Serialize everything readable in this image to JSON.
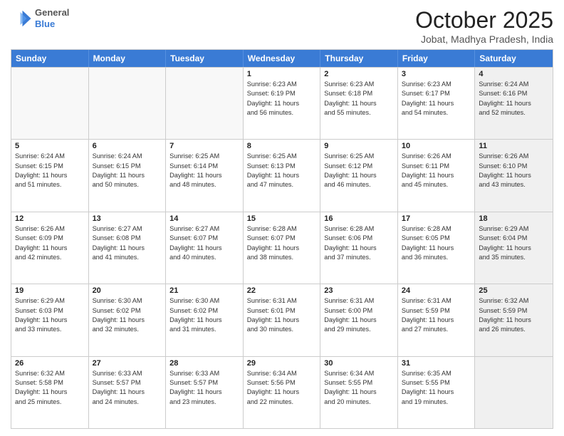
{
  "header": {
    "logo": {
      "general": "General",
      "blue": "Blue"
    },
    "month": "October 2025",
    "location": "Jobat, Madhya Pradesh, India"
  },
  "weekdays": [
    "Sunday",
    "Monday",
    "Tuesday",
    "Wednesday",
    "Thursday",
    "Friday",
    "Saturday"
  ],
  "rows": [
    [
      {
        "day": "",
        "lines": [],
        "empty": true
      },
      {
        "day": "",
        "lines": [],
        "empty": true
      },
      {
        "day": "",
        "lines": [],
        "empty": true
      },
      {
        "day": "1",
        "lines": [
          "Sunrise: 6:23 AM",
          "Sunset: 6:19 PM",
          "Daylight: 11 hours",
          "and 56 minutes."
        ]
      },
      {
        "day": "2",
        "lines": [
          "Sunrise: 6:23 AM",
          "Sunset: 6:18 PM",
          "Daylight: 11 hours",
          "and 55 minutes."
        ]
      },
      {
        "day": "3",
        "lines": [
          "Sunrise: 6:23 AM",
          "Sunset: 6:17 PM",
          "Daylight: 11 hours",
          "and 54 minutes."
        ]
      },
      {
        "day": "4",
        "lines": [
          "Sunrise: 6:24 AM",
          "Sunset: 6:16 PM",
          "Daylight: 11 hours",
          "and 52 minutes."
        ],
        "shaded": true
      }
    ],
    [
      {
        "day": "5",
        "lines": [
          "Sunrise: 6:24 AM",
          "Sunset: 6:15 PM",
          "Daylight: 11 hours",
          "and 51 minutes."
        ]
      },
      {
        "day": "6",
        "lines": [
          "Sunrise: 6:24 AM",
          "Sunset: 6:15 PM",
          "Daylight: 11 hours",
          "and 50 minutes."
        ]
      },
      {
        "day": "7",
        "lines": [
          "Sunrise: 6:25 AM",
          "Sunset: 6:14 PM",
          "Daylight: 11 hours",
          "and 48 minutes."
        ]
      },
      {
        "day": "8",
        "lines": [
          "Sunrise: 6:25 AM",
          "Sunset: 6:13 PM",
          "Daylight: 11 hours",
          "and 47 minutes."
        ]
      },
      {
        "day": "9",
        "lines": [
          "Sunrise: 6:25 AM",
          "Sunset: 6:12 PM",
          "Daylight: 11 hours",
          "and 46 minutes."
        ]
      },
      {
        "day": "10",
        "lines": [
          "Sunrise: 6:26 AM",
          "Sunset: 6:11 PM",
          "Daylight: 11 hours",
          "and 45 minutes."
        ]
      },
      {
        "day": "11",
        "lines": [
          "Sunrise: 6:26 AM",
          "Sunset: 6:10 PM",
          "Daylight: 11 hours",
          "and 43 minutes."
        ],
        "shaded": true
      }
    ],
    [
      {
        "day": "12",
        "lines": [
          "Sunrise: 6:26 AM",
          "Sunset: 6:09 PM",
          "Daylight: 11 hours",
          "and 42 minutes."
        ]
      },
      {
        "day": "13",
        "lines": [
          "Sunrise: 6:27 AM",
          "Sunset: 6:08 PM",
          "Daylight: 11 hours",
          "and 41 minutes."
        ]
      },
      {
        "day": "14",
        "lines": [
          "Sunrise: 6:27 AM",
          "Sunset: 6:07 PM",
          "Daylight: 11 hours",
          "and 40 minutes."
        ]
      },
      {
        "day": "15",
        "lines": [
          "Sunrise: 6:28 AM",
          "Sunset: 6:07 PM",
          "Daylight: 11 hours",
          "and 38 minutes."
        ]
      },
      {
        "day": "16",
        "lines": [
          "Sunrise: 6:28 AM",
          "Sunset: 6:06 PM",
          "Daylight: 11 hours",
          "and 37 minutes."
        ]
      },
      {
        "day": "17",
        "lines": [
          "Sunrise: 6:28 AM",
          "Sunset: 6:05 PM",
          "Daylight: 11 hours",
          "and 36 minutes."
        ]
      },
      {
        "day": "18",
        "lines": [
          "Sunrise: 6:29 AM",
          "Sunset: 6:04 PM",
          "Daylight: 11 hours",
          "and 35 minutes."
        ],
        "shaded": true
      }
    ],
    [
      {
        "day": "19",
        "lines": [
          "Sunrise: 6:29 AM",
          "Sunset: 6:03 PM",
          "Daylight: 11 hours",
          "and 33 minutes."
        ]
      },
      {
        "day": "20",
        "lines": [
          "Sunrise: 6:30 AM",
          "Sunset: 6:02 PM",
          "Daylight: 11 hours",
          "and 32 minutes."
        ]
      },
      {
        "day": "21",
        "lines": [
          "Sunrise: 6:30 AM",
          "Sunset: 6:02 PM",
          "Daylight: 11 hours",
          "and 31 minutes."
        ]
      },
      {
        "day": "22",
        "lines": [
          "Sunrise: 6:31 AM",
          "Sunset: 6:01 PM",
          "Daylight: 11 hours",
          "and 30 minutes."
        ]
      },
      {
        "day": "23",
        "lines": [
          "Sunrise: 6:31 AM",
          "Sunset: 6:00 PM",
          "Daylight: 11 hours",
          "and 29 minutes."
        ]
      },
      {
        "day": "24",
        "lines": [
          "Sunrise: 6:31 AM",
          "Sunset: 5:59 PM",
          "Daylight: 11 hours",
          "and 27 minutes."
        ]
      },
      {
        "day": "25",
        "lines": [
          "Sunrise: 6:32 AM",
          "Sunset: 5:59 PM",
          "Daylight: 11 hours",
          "and 26 minutes."
        ],
        "shaded": true
      }
    ],
    [
      {
        "day": "26",
        "lines": [
          "Sunrise: 6:32 AM",
          "Sunset: 5:58 PM",
          "Daylight: 11 hours",
          "and 25 minutes."
        ]
      },
      {
        "day": "27",
        "lines": [
          "Sunrise: 6:33 AM",
          "Sunset: 5:57 PM",
          "Daylight: 11 hours",
          "and 24 minutes."
        ]
      },
      {
        "day": "28",
        "lines": [
          "Sunrise: 6:33 AM",
          "Sunset: 5:57 PM",
          "Daylight: 11 hours",
          "and 23 minutes."
        ]
      },
      {
        "day": "29",
        "lines": [
          "Sunrise: 6:34 AM",
          "Sunset: 5:56 PM",
          "Daylight: 11 hours",
          "and 22 minutes."
        ]
      },
      {
        "day": "30",
        "lines": [
          "Sunrise: 6:34 AM",
          "Sunset: 5:55 PM",
          "Daylight: 11 hours",
          "and 20 minutes."
        ]
      },
      {
        "day": "31",
        "lines": [
          "Sunrise: 6:35 AM",
          "Sunset: 5:55 PM",
          "Daylight: 11 hours",
          "and 19 minutes."
        ]
      },
      {
        "day": "",
        "lines": [],
        "empty": true,
        "shaded": true
      }
    ]
  ]
}
